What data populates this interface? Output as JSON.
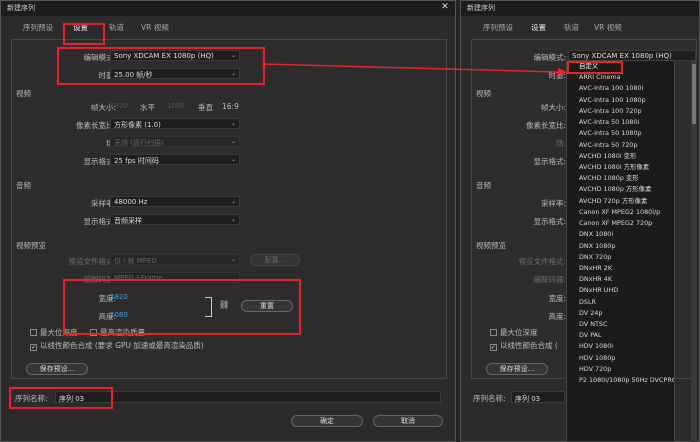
{
  "left": {
    "title": "新建序列",
    "tabs": [
      "序列预设",
      "设置",
      "轨道",
      "VR 视频"
    ],
    "editing_mode": {
      "label": "编辑模式:",
      "value": "Sony XDCAM EX 1080p (HQ)"
    },
    "timebase": {
      "label": "时基:",
      "value": "25.00  帧/秒"
    },
    "video": {
      "section": "视频",
      "frame_size": {
        "label": "帧大小:",
        "width": "1920",
        "h_label": "水平",
        "height": "1080",
        "v_label": "垂直",
        "ratio": "16:9"
      },
      "pixel_aspect": {
        "label": "像素长宽比:",
        "value": "方形像素 (1.0)"
      },
      "fields": {
        "label": "场:",
        "value": "无场 (逐行扫描)"
      },
      "display_format": {
        "label": "显示格式:",
        "value": "25 fps 时间码"
      }
    },
    "audio": {
      "section": "音频",
      "sample_rate": {
        "label": "采样率:",
        "value": "48000 Hz"
      },
      "display_format": {
        "label": "显示格式:",
        "value": "音频采样"
      }
    },
    "preview": {
      "section": "视频预览",
      "file_format": {
        "label": "预览文件格式:",
        "value": "仅 I 帧 MPEG",
        "button": "配置..."
      },
      "codec": {
        "label": "编解码器:",
        "value": "MPEG I-Frame"
      },
      "width": {
        "label": "宽度:",
        "value": "1920"
      },
      "height": {
        "label": "高度:",
        "value": "1080"
      },
      "reset_button": "重置"
    },
    "max_bit_depth": "最大位深度",
    "max_render_quality": "最高渲染质量",
    "linear_color": "以线性颜色合成 (要求 GPU 加速或最高渲染品质)",
    "save_preset": "保存预设...",
    "sequence_name": {
      "label": "序列名称:",
      "value": "序列 03"
    },
    "ok": "确定",
    "cancel": "取消"
  },
  "right": {
    "title": "新建序列",
    "tabs": [
      "序列预设",
      "设置",
      "轨道",
      "VR 视频"
    ],
    "editing_mode": {
      "label": "编辑模式:",
      "value": "Sony XDCAM EX 1080p (HQ)"
    },
    "timebase_label": "时基:",
    "video_section": "视频",
    "video_labels": [
      "帧大小:",
      "像素长宽比:",
      "场:",
      "显示格式:"
    ],
    "audio_section": "音频",
    "audio_labels": [
      "采样率:",
      "显示格式:"
    ],
    "preview_section": "视频预览",
    "preview_labels": [
      "预览文件格式:",
      "编解码器:",
      "宽度:",
      "高度:"
    ],
    "max_bit_depth": "最大位深度",
    "linear_color": "以线性颜色合成 (",
    "save_preset": "保存预设...",
    "sequence_name": {
      "label": "序列名称:",
      "value": "序列 03"
    },
    "dropdown_items": [
      "自定义",
      "ARRI Cinema",
      "AVC-Intra 100 1080i",
      "AVC-Intra 100 1080p",
      "AVC-Intra 100 720p",
      "AVC-Intra 50 1080i",
      "AVC-Intra 50 1080p",
      "AVC-Intra 50 720p",
      "AVCHD 1080i 变形",
      "AVCHD 1080i 方形像素",
      "AVCHD 1080p 变形",
      "AVCHD 1080p 方形像素",
      "AVCHD 720p 方形像素",
      "Canon XF MPEG2 1080i/p",
      "Canon XF MPEG2 720p",
      "DNX 1080i",
      "DNX 1080p",
      "DNX 720p",
      "DNxHR 2K",
      "DNxHR 4K",
      "DNxHR UHD",
      "DSLR",
      "DV 24p",
      "DV NTSC",
      "DV PAL",
      "HDV 1080i",
      "HDV 1080p",
      "HDV 720p",
      "P2 1080i/1080p 50Hz DVCPROHD"
    ]
  },
  "colors": {
    "highlight": "#e8222a",
    "accent_blue": "#4d9de0"
  }
}
